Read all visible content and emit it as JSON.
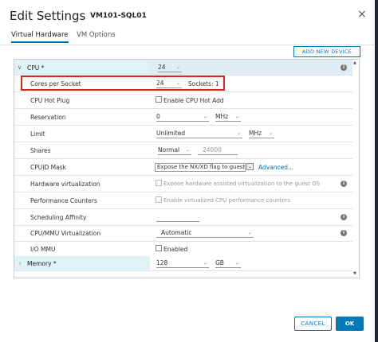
{
  "dialog": {
    "title": "Edit Settings",
    "vm_name": "VM101-SQL01",
    "close": "×"
  },
  "tabs": [
    {
      "label": "Virtual Hardware",
      "active": true
    },
    {
      "label": "VM Options",
      "active": false
    }
  ],
  "add_device_label": "ADD NEW DEVICE",
  "cpu": {
    "label": "CPU *",
    "value": "24",
    "cores_per_socket_label": "Cores per Socket",
    "cores_per_socket_value": "24",
    "sockets_text": "Sockets: 1",
    "hot_plug_label": "CPU Hot Plug",
    "hot_plug_checkbox_label": "Enable CPU Hot Add",
    "reservation_label": "Reservation",
    "reservation_value": "0",
    "reservation_unit": "MHz",
    "limit_label": "Limit",
    "limit_value": "Unlimited",
    "limit_unit": "MHz",
    "shares_label": "Shares",
    "shares_level": "Normal",
    "shares_value": "24000",
    "cpuid_label": "CPUID Mask",
    "cpuid_value": "Expose the NX/XD flag to guest",
    "cpuid_advanced": "Advanced...",
    "hw_virt_label": "Hardware virtualization",
    "hw_virt_text": "Expose hardware assisted virtualization to the guest OS",
    "perf_label": "Performance Counters",
    "perf_text": "Enable virtualized CPU performance counters",
    "affinity_label": "Scheduling Affinity",
    "mmu_label": "CPU/MMU Virtualization",
    "mmu_value": "Automatic",
    "iommu_label": "I/O MMU",
    "iommu_text": "Enabled"
  },
  "memory": {
    "label": "Memory *",
    "value": "128",
    "unit": "GB"
  },
  "icons": {
    "info": "i",
    "chevron_down": "⌄",
    "expand": "∨",
    "collapse": "›"
  },
  "footer": {
    "cancel": "CANCEL",
    "ok": "OK"
  },
  "colors": {
    "accent": "#0079b8",
    "highlight": "#d9251d"
  }
}
